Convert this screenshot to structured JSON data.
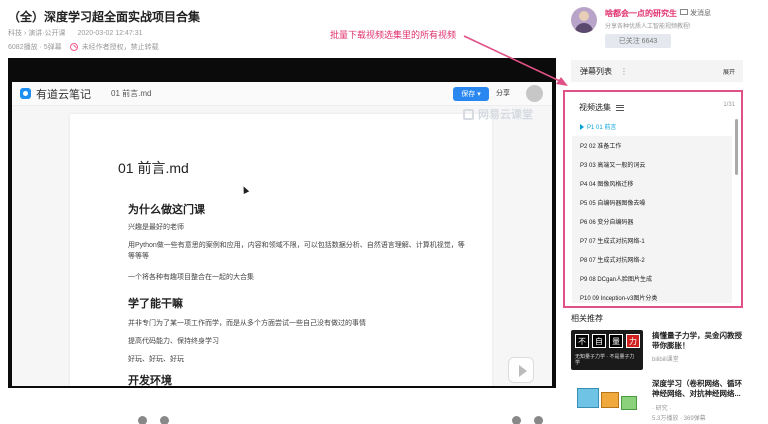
{
  "video": {
    "title": "（全）深度学习超全面实战项目合集",
    "category": "科技 › 演讲·公开课",
    "datetime": "2020-03-02 12:47:31",
    "stats": "6082播放 · 5弹幕",
    "warning": "未经作者授权，禁止转载"
  },
  "player": {
    "app_name": "有道云笔记",
    "file_tab": "01 前言.md",
    "save_label": "保存 ▾",
    "share_label": "分享",
    "watermark": "网易云课堂"
  },
  "doc": {
    "h1": "01 前言.md",
    "sections": [
      {
        "heading": "为什么做这门课",
        "paras": [
          "兴趣是最好的老师",
          "用Python做一些有意思的案例和应用，内容和领域不限，可以包括数据分析、自然语言理解、计算机视觉，等等等等",
          "一个将各种有趣项目整合在一起的大合集"
        ]
      },
      {
        "heading": "学了能干嘛",
        "paras": [
          "并非专门为了某一项工作而学，而是从多个方面尝试一些自己没有做过的事情",
          "提高代码能力、保持终身学习",
          "好玩、好玩、好玩"
        ]
      },
      {
        "heading": "开发环境",
        "paras": []
      }
    ]
  },
  "annotation": {
    "text": "批量下载视频选集里的所有视频",
    "color": "#e0306e"
  },
  "uploader": {
    "name": "啥都会一点的研究生",
    "message_label": "发消息",
    "description": "分享各种优质人工智能视频教程!",
    "follow_label": "已关注 6643"
  },
  "danmaku": {
    "label": "弹幕列表",
    "more": "⋮",
    "expand_label": "展开"
  },
  "playlist": {
    "title": "视频选集",
    "count": "1/31",
    "items": [
      {
        "label": "P1  01 前言",
        "active": true
      },
      {
        "label": "P2  02 准备工作",
        "active": false
      },
      {
        "label": "P3  03 高端又一般的词云",
        "active": false
      },
      {
        "label": "P4  04 图像风格迁移",
        "active": false
      },
      {
        "label": "P5  05 自编码器图像去噪",
        "active": false
      },
      {
        "label": "P6  06 变分自编码器",
        "active": false
      },
      {
        "label": "P7  07 生成式对抗网络-1",
        "active": false
      },
      {
        "label": "P8  07 生成式对抗网络-2",
        "active": false
      },
      {
        "label": "P9  08 DCgan人脸图片生成",
        "active": false
      },
      {
        "label": "P10  09 Inception-v3图片分类",
        "active": false
      }
    ]
  },
  "recommendations": {
    "title": "相关推荐",
    "items": [
      {
        "name": "搞懂量子力学，吴金闪教授带你膨胀！",
        "author": "bilibili课堂",
        "stats": "",
        "thumb_chars": [
          "不",
          "自",
          "量",
          "力"
        ],
        "thumb_sub": "无知量子力学 · 不是量子力学"
      },
      {
        "name": "深度学习（卷积网络、循环神经网络、对抗神经网络...",
        "author": "· 研究 ·",
        "stats": "5.3万播放 · 369弹幕",
        "thumb_chars": [],
        "thumb_sub": ""
      }
    ]
  },
  "colors": {
    "accent_pink": "#e05287",
    "link_blue": "#00a1d6",
    "save_blue": "#2a87f0"
  }
}
